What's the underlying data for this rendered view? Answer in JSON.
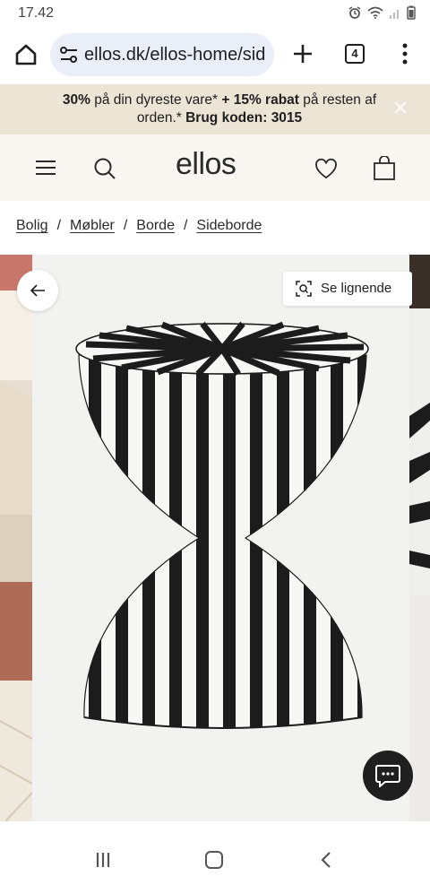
{
  "status_bar": {
    "time": "17.42"
  },
  "browser": {
    "url": "ellos.dk/ellos-home/sid",
    "tab_count": "4"
  },
  "promo": {
    "part1_bold": "30%",
    "part2": " på din dyreste vare* ",
    "part3_bold": "+ 15% rabat",
    "part4": " på resten af orden.* ",
    "part5_bold": "Brug koden: 3015"
  },
  "header": {
    "logo": "ellos"
  },
  "breadcrumb": {
    "items": [
      "Bolig",
      "Møbler",
      "Borde",
      "Sideborde"
    ],
    "separator": "/"
  },
  "gallery": {
    "similar_button": "Se lignende"
  },
  "colors": {
    "promo_bg": "#ece4d5",
    "header_bg": "#faf7f3",
    "url_pill_bg": "#e9eef8",
    "chat_bg": "#1f1f1f"
  },
  "icons": {
    "home": "home-icon",
    "url_settings": "tune-icon",
    "new_tab": "plus-icon",
    "tabs": "tabs-icon",
    "menu": "kebab-icon",
    "close": "close-icon",
    "hamburger": "hamburger-icon",
    "search": "search-icon",
    "wishlist": "heart-icon",
    "bag": "shopping-bag-icon",
    "back": "arrow-left-icon",
    "visual_search": "visual-search-icon",
    "chat": "chat-icon"
  }
}
